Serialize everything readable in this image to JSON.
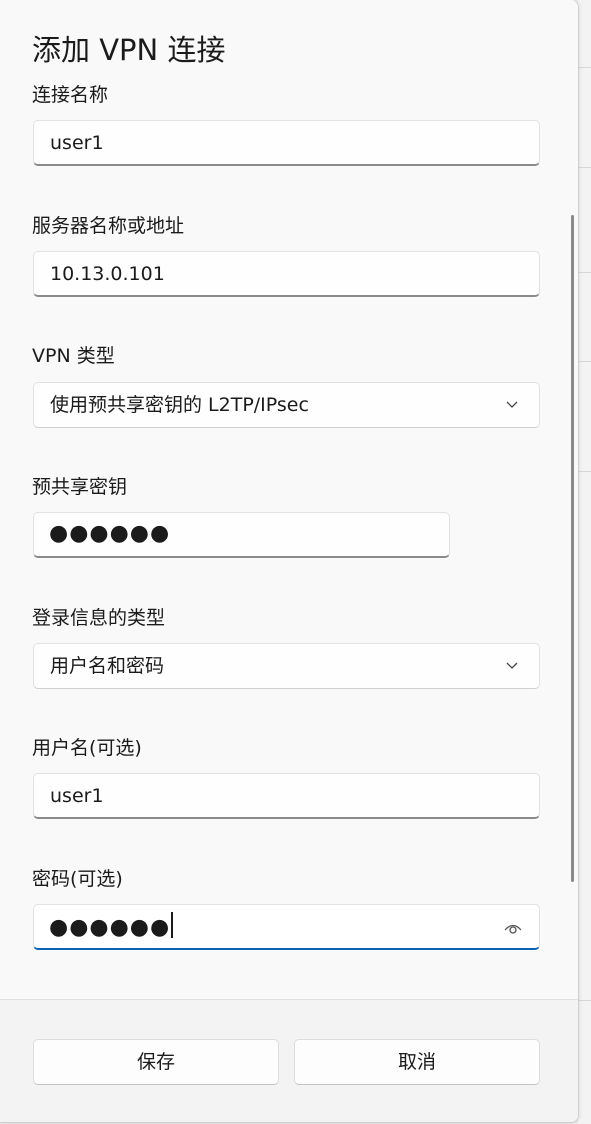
{
  "dialog": {
    "title": "添加 VPN 连接",
    "fields": {
      "connection_name": {
        "label": "连接名称",
        "value": "user1"
      },
      "server": {
        "label": "服务器名称或地址",
        "value": "10.13.0.101"
      },
      "vpn_type": {
        "label": "VPN 类型",
        "value": "使用预共享密钥的 L2TP/IPsec"
      },
      "psk": {
        "label": "预共享密钥",
        "value": "●●●●●●"
      },
      "signin_type": {
        "label": "登录信息的类型",
        "value": "用户名和密码"
      },
      "username": {
        "label": "用户名(可选)",
        "value": "user1"
      },
      "password": {
        "label": "密码(可选)",
        "value": "●●●●●●"
      }
    },
    "buttons": {
      "save": "保存",
      "cancel": "取消"
    }
  },
  "icons": {
    "dropdown": "chevron-down-icon",
    "reveal": "eye-icon"
  },
  "colors": {
    "accent": "#0a62b5",
    "dialog_bg": "#f9f9f9",
    "footer_bg": "#f3f3f3"
  }
}
